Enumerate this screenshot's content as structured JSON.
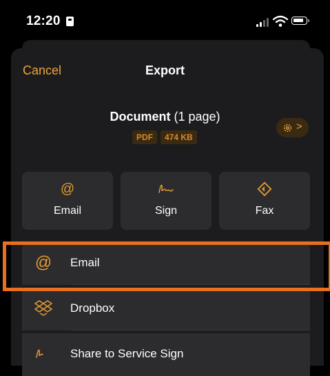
{
  "status_bar": {
    "time": "12:20"
  },
  "header": {
    "cancel_label": "Cancel",
    "title": "Export"
  },
  "document": {
    "name": "Document",
    "pages": "(1 page)",
    "format_badge": "PDF",
    "size_badge": "474 KB"
  },
  "actions": [
    {
      "label": "Email",
      "icon": "at-icon"
    },
    {
      "label": "Sign",
      "icon": "signature-icon"
    },
    {
      "label": "Fax",
      "icon": "fax-icon"
    }
  ],
  "list": [
    {
      "label": "Email",
      "icon": "at-icon"
    },
    {
      "label": "Dropbox",
      "icon": "dropbox-icon"
    },
    {
      "label": "Share to Service Sign",
      "icon": "signature-icon"
    }
  ],
  "colors": {
    "accent": "#E59A32",
    "highlight": "#E8701E",
    "sheet": "#1C1C1E",
    "tile": "#2C2C2E"
  }
}
